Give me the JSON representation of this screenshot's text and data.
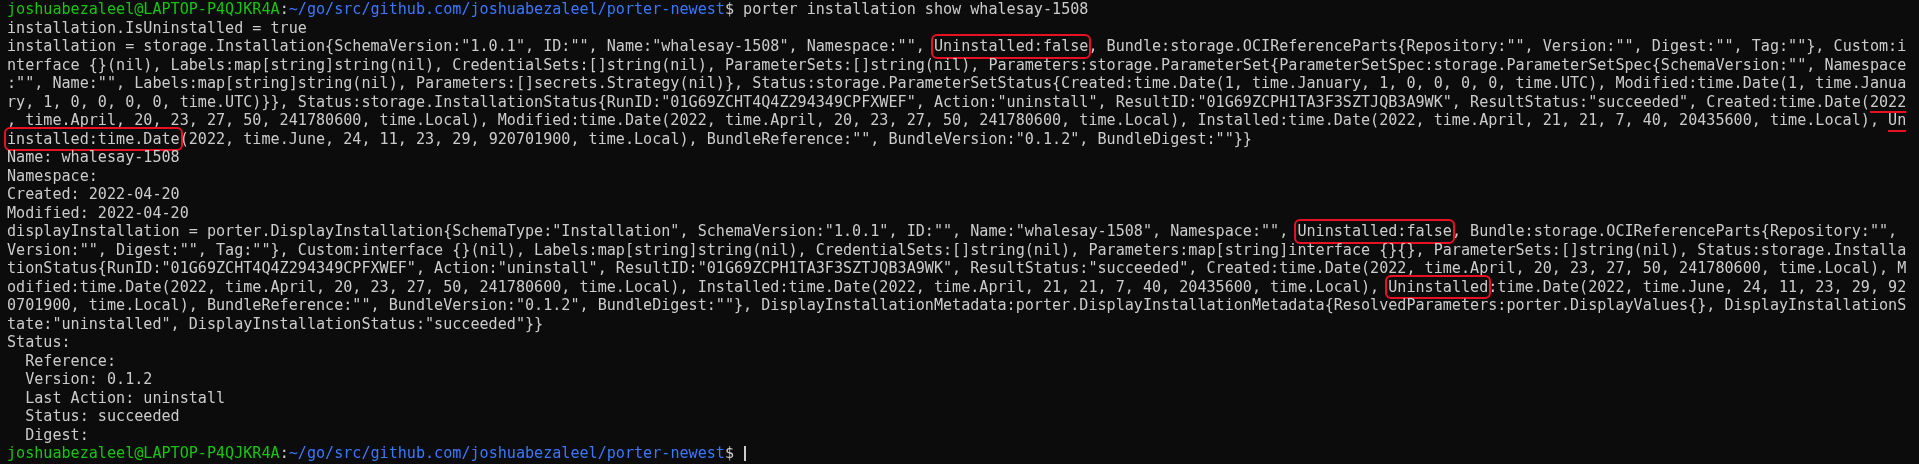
{
  "terminal": {
    "lines": [
      {
        "segments": [
          {
            "text": "joshuabezaleel@LAPTOP-P4QJKR4A",
            "kind": "user"
          },
          {
            "text": ":"
          },
          {
            "text": "~/go/src/github.com/joshuabezaleel/porter-newest",
            "kind": "path"
          },
          {
            "text": "$ porter installation show whalesay-1508"
          }
        ]
      },
      {
        "text": "installation.IsUninstalled = true"
      },
      {
        "segments": [
          {
            "text": "installation = storage.Installation{SchemaVersion:\"1.0.1\", ID:\"\", Name:\"whalesay-1508\", Namespace:\"\", "
          },
          {
            "text": "Uninstalled:false",
            "circled": true
          },
          {
            "text": ", Bundle:storage.OCIReferenceParts{Repository:\"\", Version:\"\", Digest:\"\", Tag:\"\"}, Custom:i"
          }
        ]
      },
      {
        "text": "nterface {}(nil), Labels:map[string]string(nil), CredentialSets:[]string(nil), ParameterSets:[]string(nil), Parameters:storage.ParameterSet{ParameterSetSpec:storage.ParameterSetSpec{SchemaVersion:\"\", Namespace"
      },
      {
        "text": ":\"\", Name:\"\", Labels:map[string]string(nil), Parameters:[]secrets.Strategy(nil)}, Status:storage.ParameterSetStatus{Created:time.Date(1, time.January, 1, 0, 0, 0, 0, time.UTC), Modified:time.Date(1, time.Janua"
      },
      {
        "segments": [
          {
            "text": "ry, 1, 0, 0, 0, 0, time.UTC)}}, Status:storage.InstallationStatus{RunID:\"01G69ZCHT4Q4Z294349CPFXWEF\", Action:\"uninstall\", ResultID:\"01G69ZCPH1TA3F3SZTJQB3A9WK\", ResultStatus:\"succeeded\", Created:time.Date("
          },
          {
            "text": "2022",
            "underlined": true
          }
        ]
      },
      {
        "segments": [
          {
            "text": ", time.April, 20, 23, 27, 50, 241780600, time.Local), Modified:time.Date(2022, time.April, 20, 23, 27, 50, 241780600, time.Local), Installed:time.Date(2022, time.April, 21, 21, 7, 40, 20435600, time.Local), "
          },
          {
            "text": "Un",
            "underlined": true
          }
        ]
      },
      {
        "segments": [
          {
            "text": "installed:time.Date",
            "circled": true
          },
          {
            "text": "(2022, time.June, 24, 11, 23, 29, 920701900, time.Local), BundleReference:\"\", BundleVersion:\"0.1.2\", BundleDigest:\"\"}}"
          }
        ]
      },
      {
        "text": "Name: whalesay-1508"
      },
      {
        "text": "Namespace:"
      },
      {
        "text": "Created: 2022-04-20"
      },
      {
        "text": "Modified: 2022-04-20"
      },
      {
        "segments": [
          {
            "text": "displayInstallation = porter.DisplayInstallation{SchemaType:\"Installation\", SchemaVersion:\"1.0.1\", ID:\"\", Name:\"whalesay-1508\", Namespace:\"\", "
          },
          {
            "text": "Uninstalled:false",
            "circled": true
          },
          {
            "text": ", Bundle:storage.OCIReferenceParts{Repository:\"\","
          }
        ]
      },
      {
        "text": "Version:\"\", Digest:\"\", Tag:\"\"}, Custom:interface {}(nil), Labels:map[string]string(nil), CredentialSets:[]string(nil), Parameters:map[string]interface {}{}, ParameterSets:[]string(nil), Status:storage.Installa"
      },
      {
        "text": "tionStatus{RunID:\"01G69ZCHT4Q4Z294349CPFXWEF\", Action:\"uninstall\", ResultID:\"01G69ZCPH1TA3F3SZTJQB3A9WK\", ResultStatus:\"succeeded\", Created:time.Date(2022, time.April, 20, 23, 27, 50, 241780600, time.Local), M"
      },
      {
        "segments": [
          {
            "text": "odified:time.Date(2022, time.April, 20, 23, 27, 50, 241780600, time.Local), Installed:time.Date(2022, time.April, 21, 21, 7, 40, 20435600, time.Local), "
          },
          {
            "text": "Uninstalled",
            "circled": true
          },
          {
            "text": ":time.Date(2022, time.June, 24, 11, 23, 29, 92"
          }
        ]
      },
      {
        "text": "0701900, time.Local), BundleReference:\"\", BundleVersion:\"0.1.2\", BundleDigest:\"\"}, DisplayInstallationMetadata:porter.DisplayInstallationMetadata{ResolvedParameters:porter.DisplayValues{}, DisplayInstallationS"
      },
      {
        "text": "tate:\"uninstalled\", DisplayInstallationStatus:\"succeeded\"}}"
      },
      {
        "text": "Status:"
      },
      {
        "text": "  Reference:"
      },
      {
        "text": "  Version: 0.1.2"
      },
      {
        "text": "  Last Action: uninstall"
      },
      {
        "text": "  Status: succeeded"
      },
      {
        "text": "  Digest:"
      },
      {
        "segments": [
          {
            "text": "joshuabezaleel@LAPTOP-P4QJKR4A",
            "kind": "user"
          },
          {
            "text": ":"
          },
          {
            "text": "~/go/src/github.com/joshuabezaleel/porter-newest",
            "kind": "path"
          },
          {
            "text": "$ "
          }
        ],
        "cursor": true
      }
    ]
  }
}
